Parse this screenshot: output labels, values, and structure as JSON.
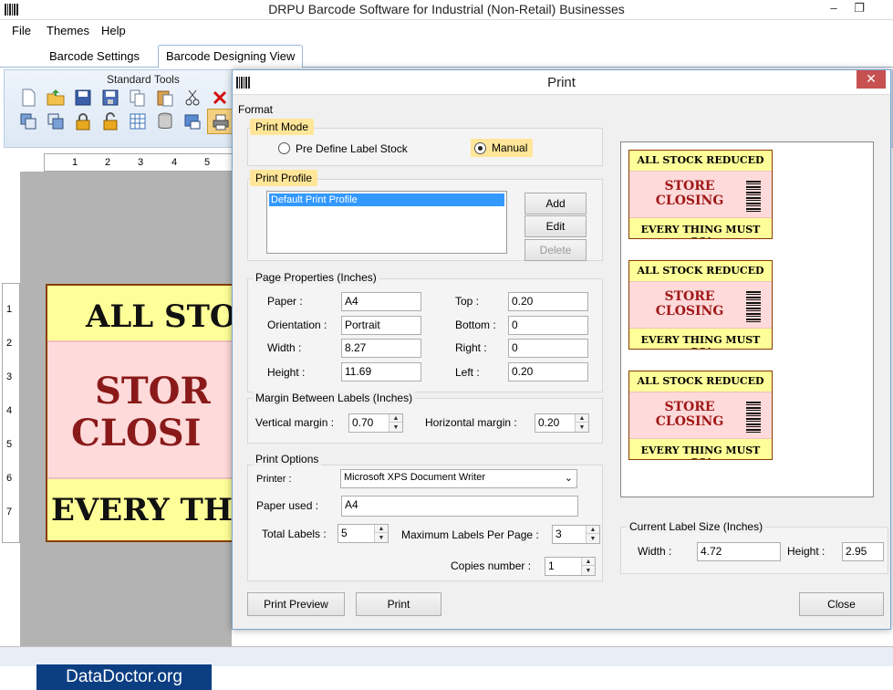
{
  "app": {
    "title": "DRPU Barcode Software for Industrial (Non-Retail) Businesses",
    "menu": [
      "File",
      "Themes",
      "Help"
    ],
    "tabs": [
      "Barcode Settings",
      "Barcode Designing View"
    ],
    "toolbar_title": "Standard Tools",
    "ruler_h": [
      "1",
      "2",
      "3",
      "4",
      "5"
    ],
    "ruler_v": [
      "1",
      "2",
      "3",
      "4",
      "5",
      "6",
      "7"
    ],
    "canvas_label": {
      "top": "ALL STOC",
      "middle1": "STOR",
      "middle2": "CLOSI",
      "bottom": "EVERY THI"
    },
    "brand": "DataDoctor.org"
  },
  "dialog": {
    "title": "Print",
    "close_glyph": "✕",
    "format_label": "Format",
    "print_mode": {
      "title": "Print Mode",
      "option_predefine": "Pre Define Label Stock",
      "option_manual": "Manual"
    },
    "print_profile": {
      "title": "Print Profile",
      "items": [
        "Default Print Profile"
      ],
      "add": "Add",
      "edit": "Edit",
      "delete": "Delete"
    },
    "page_properties": {
      "title": "Page Properties (Inches)",
      "paper_label": "Paper :",
      "paper": "A4",
      "orientation_label": "Orientation :",
      "orientation": "Portrait",
      "width_label": "Width :",
      "width": "8.27",
      "height_label": "Height :",
      "height": "11.69",
      "top_label": "Top :",
      "top": "0.20",
      "bottom_label": "Bottom :",
      "bottom": "0",
      "right_label": "Right :",
      "right": "0",
      "left_label": "Left :",
      "left": "0.20"
    },
    "margin": {
      "title": "Margin Between Labels (Inches)",
      "vertical_label": "Vertical margin :",
      "vertical": "0.70",
      "horizontal_label": "Horizontal margin :",
      "horizontal": "0.20"
    },
    "print_options": {
      "title": "Print Options",
      "printer_label": "Printer :",
      "printer": "Microsoft XPS Document Writer",
      "paper_used_label": "Paper used :",
      "paper_used": "A4",
      "total_labels_label": "Total Labels :",
      "total_labels": "5",
      "max_per_page_label": "Maximum Labels Per Page :",
      "max_per_page": "3",
      "copies_label": "Copies number :",
      "copies": "1"
    },
    "preview_labels": [
      {
        "top": "ALL STOCK REDUCED",
        "store": "STORE",
        "closing": "CLOSING",
        "bottom": "EVERY THING MUST GO!"
      },
      {
        "top": "ALL STOCK REDUCED",
        "store": "STORE",
        "closing": "CLOSING",
        "bottom": "EVERY THING MUST GO!"
      },
      {
        "top": "ALL STOCK REDUCED",
        "store": "STORE",
        "closing": "CLOSING",
        "bottom": "EVERY THING MUST GO!"
      }
    ],
    "current_size": {
      "title": "Current Label Size (Inches)",
      "width_label": "Width :",
      "width": "4.72",
      "height_label": "Height :",
      "height": "2.95"
    },
    "buttons": {
      "preview": "Print Preview",
      "print": "Print",
      "close": "Close"
    }
  }
}
